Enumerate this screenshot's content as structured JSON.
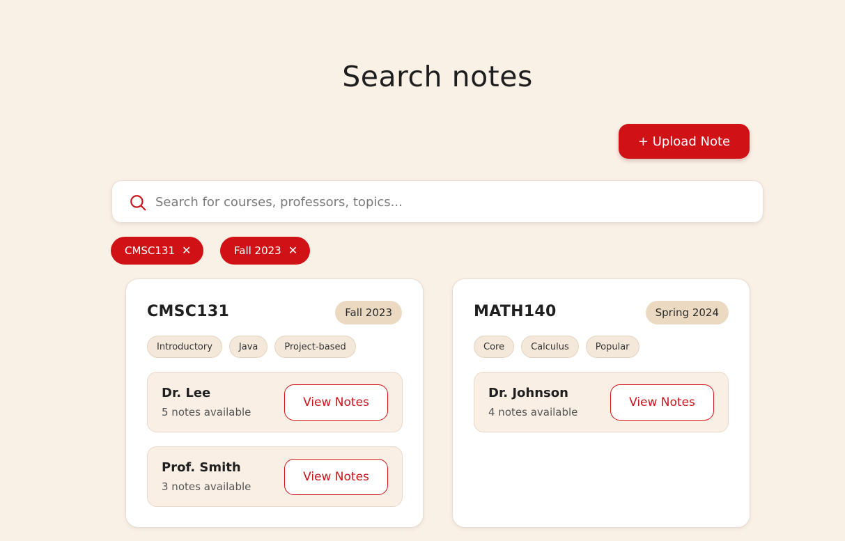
{
  "page": {
    "title": "Search notes"
  },
  "upload": {
    "label": "+ Upload Note"
  },
  "search": {
    "placeholder": "Search for courses, professors, topics...",
    "value": ""
  },
  "filters": [
    {
      "label": "CMSC131",
      "close": "✕"
    },
    {
      "label": "Fall 2023",
      "close": "✕"
    }
  ],
  "colors": {
    "accent": "#d01116",
    "background": "#f9f0e6",
    "badge": "#ebd9c2",
    "tag": "#f4e8da"
  },
  "cards": [
    {
      "course": "CMSC131",
      "term": "Fall 2023",
      "tags": [
        "Introductory",
        "Java",
        "Project-based"
      ],
      "professors": [
        {
          "name": "Dr. Lee",
          "count": "5 notes available",
          "button": "View Notes"
        },
        {
          "name": "Prof. Smith",
          "count": "3 notes available",
          "button": "View Notes"
        }
      ]
    },
    {
      "course": "MATH140",
      "term": "Spring 2024",
      "tags": [
        "Core",
        "Calculus",
        "Popular"
      ],
      "professors": [
        {
          "name": "Dr. Johnson",
          "count": "4 notes available",
          "button": "View Notes"
        }
      ]
    }
  ]
}
